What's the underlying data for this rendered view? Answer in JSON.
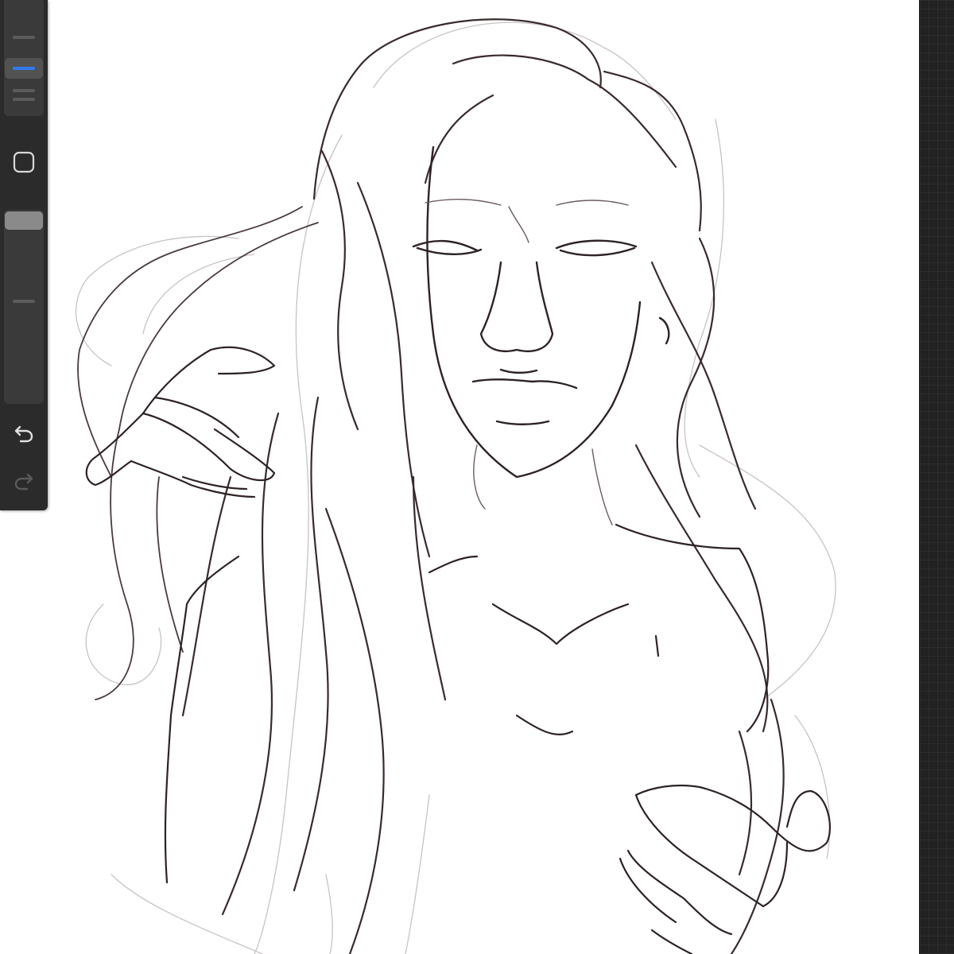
{
  "app": {
    "accent": "#2e7bf0",
    "sidebar_bg": "#2b2b2b",
    "stroke_color": "#3a2a2c"
  },
  "sidebar": {
    "brush_size_slider": {
      "icon": "brush-size-slider",
      "level": 0.4
    },
    "modify_button": {
      "icon": "square-modify-icon"
    },
    "opacity_slider": {
      "icon": "brush-opacity-slider",
      "level": 1.0
    },
    "undo_button": {
      "icon": "undo-arrow-icon"
    },
    "redo_button": {
      "icon": "redo-arrow-icon",
      "disabled": true
    }
  },
  "canvas": {
    "content": "line-art-sketch"
  }
}
